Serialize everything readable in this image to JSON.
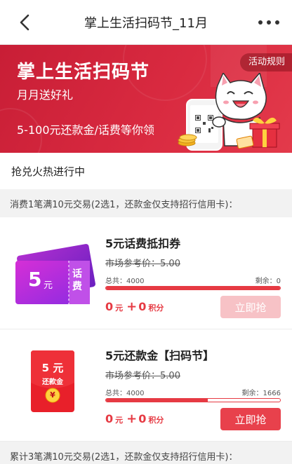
{
  "nav": {
    "title": "掌上生活扫码节_11月"
  },
  "banner": {
    "title": "掌上生活扫码节",
    "subtitle": "月月送好礼",
    "desc": "5-100元还款金/话费等你领",
    "rules_label": "活动规则"
  },
  "status_text": "抢兑火热进行中",
  "section1_header": "消费1笔满10元交易(2选1，还款金仅支持招行信用卡)：",
  "products": [
    {
      "name": "5元话费抵扣券",
      "ref_label": "市场参考价：",
      "ref_price": "5.00",
      "total_label": "总共：4000",
      "remain_label": "剩余：0",
      "progress": 1.0,
      "price_num": "0",
      "price_unit": "元",
      "plus": "+",
      "points_num": "0",
      "points_unit": "积分",
      "button_label": "立即抢",
      "button_state": "disabled",
      "image": {
        "amount": "5",
        "unit": "元",
        "label": "话费"
      }
    },
    {
      "name": "5元还款金【扫码节】",
      "ref_label": "市场参考价：",
      "ref_price": "5.00",
      "total_label": "总共：4000",
      "remain_label": "剩余：1666",
      "progress": 0.5835,
      "price_num": "0",
      "price_unit": "元",
      "plus": "+",
      "points_num": "0",
      "points_unit": "积分",
      "button_label": "立即抢",
      "button_state": "active",
      "image": {
        "amount": "5 元",
        "label": "还款金",
        "symbol": "¥"
      }
    }
  ],
  "section2_header": "累计3笔满10元交易(2选1，还款金仅支持招行信用卡)：",
  "colors": {
    "accent": "#e63a43",
    "banner": "#d92a40",
    "button_disabled": "#f7c2c6"
  }
}
